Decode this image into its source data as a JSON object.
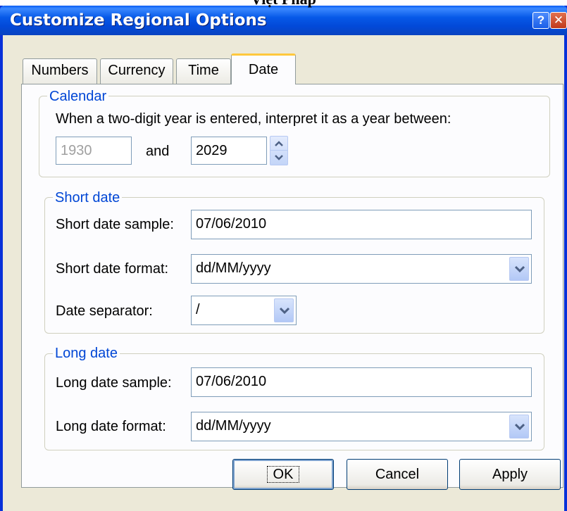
{
  "page": {
    "header_text": "Việt Pháp"
  },
  "window": {
    "title": "Customize Regional Options",
    "help_glyph": "?",
    "close_glyph": "✕"
  },
  "tabs": [
    {
      "label": "Numbers"
    },
    {
      "label": "Currency"
    },
    {
      "label": "Time"
    },
    {
      "label": "Date"
    }
  ],
  "calendar": {
    "legend": "Calendar",
    "description": "When a two-digit year is entered, interpret it as a year between:",
    "year_from": "1930",
    "and_label": "and",
    "year_to": "2029"
  },
  "short_date": {
    "legend": "Short date",
    "sample_label": "Short date sample:",
    "sample_value": "07/06/2010",
    "format_label": "Short date format:",
    "format_value": "dd/MM/yyyy",
    "separator_label": "Date separator:",
    "separator_value": "/"
  },
  "long_date": {
    "legend": "Long date",
    "sample_label": "Long date sample:",
    "sample_value": "07/06/2010",
    "format_label": "Long date format:",
    "format_value": "dd/MM/yyyy"
  },
  "buttons": {
    "ok": "OK",
    "cancel": "Cancel",
    "apply": "Apply"
  },
  "colors": {
    "accent": "#0046d5",
    "titlebar": "#0249d8",
    "tab_highlight": "#ffc83c"
  }
}
